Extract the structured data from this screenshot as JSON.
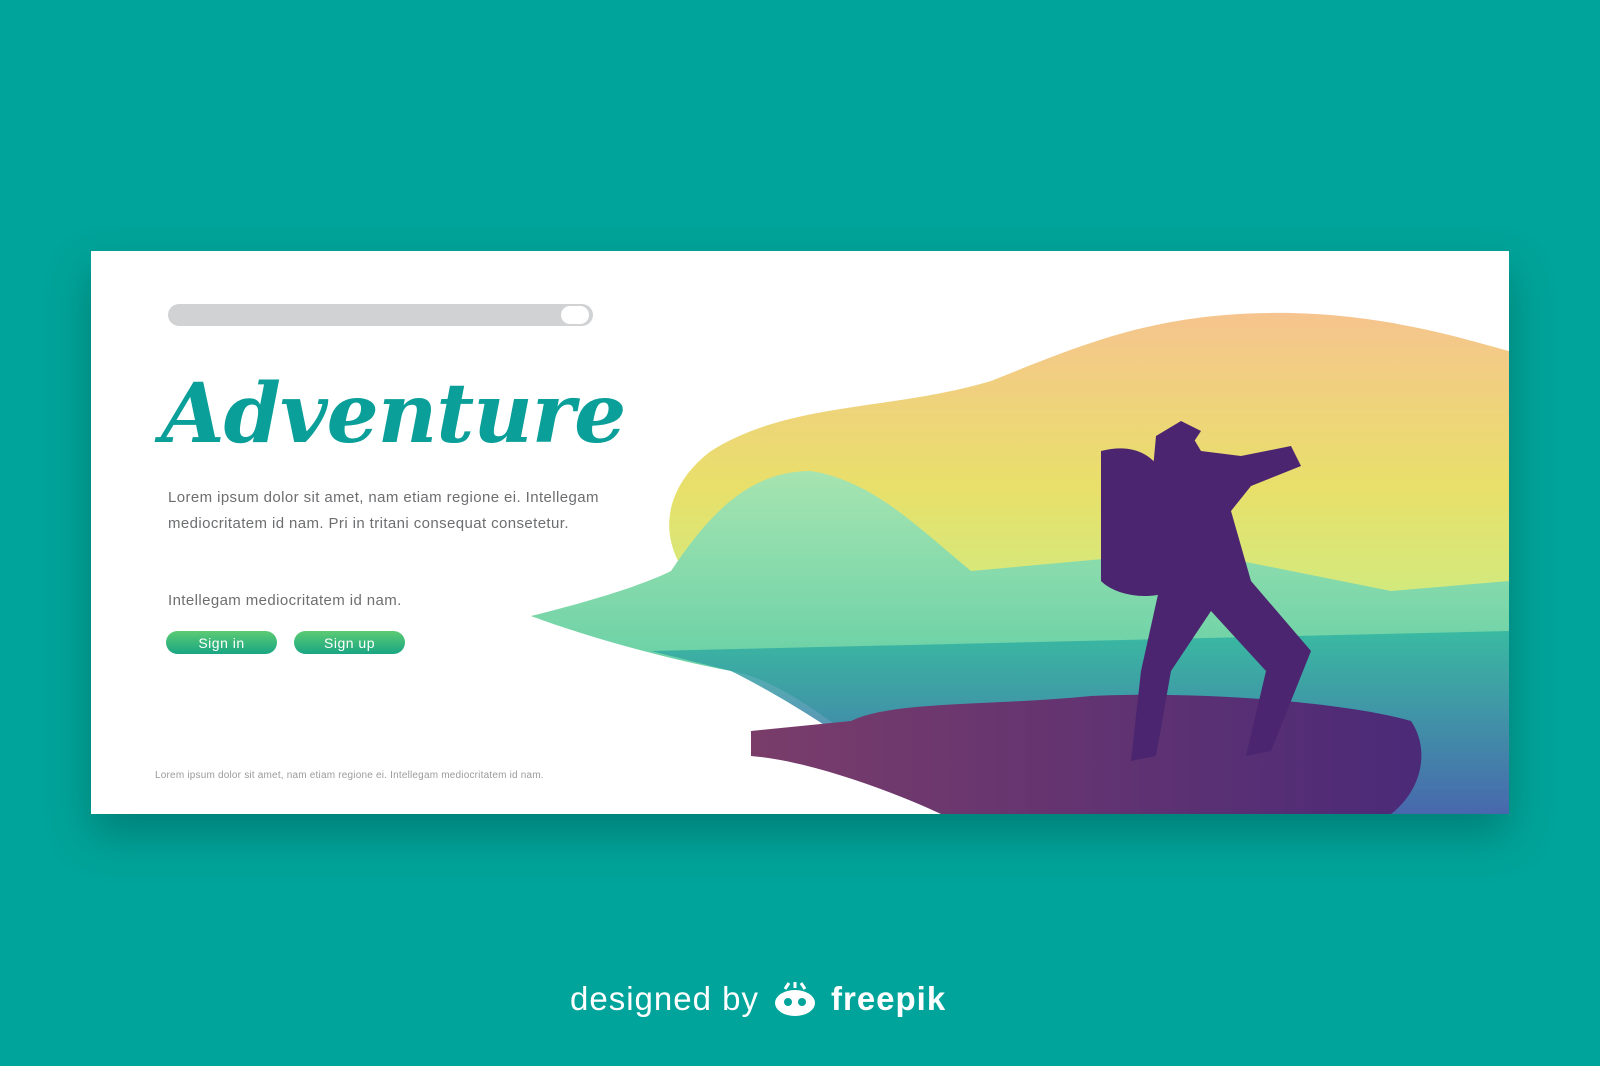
{
  "search": {
    "placeholder": ""
  },
  "hero": {
    "title": "Adventure",
    "paragraph": "Lorem ipsum dolor sit amet, nam etiam regione ei. Intellegam mediocritatem id nam. Pri in tritani consequat consetetur.",
    "subtext": "Intellegam mediocritatem id nam."
  },
  "buttons": {
    "sign_in": "Sign in",
    "sign_up": "Sign up"
  },
  "footer": {
    "text": "Lorem ipsum dolor sit amet, nam etiam regione ei. Intellegam mediocritatem id nam."
  },
  "credit": {
    "prefix": "designed by",
    "brand": "freepik"
  },
  "colors": {
    "background": "#00a49a",
    "accent": "#0a9f99",
    "button": "#2bb37c"
  }
}
